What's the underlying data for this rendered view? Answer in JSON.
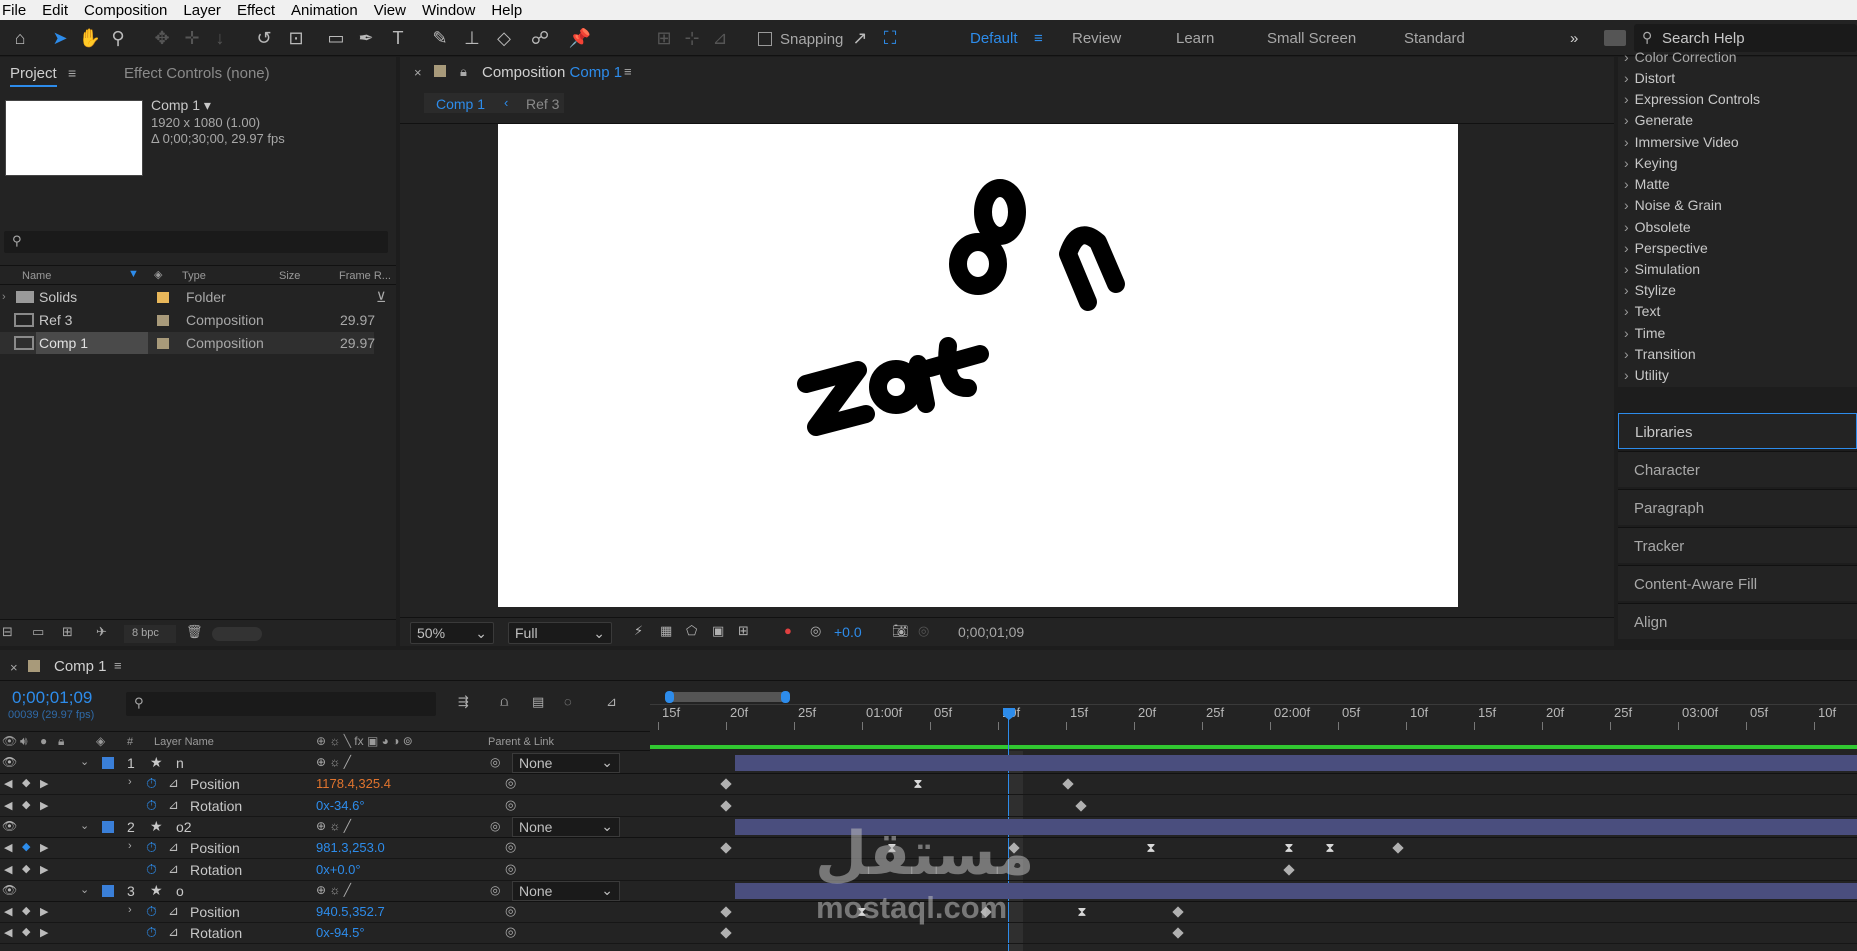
{
  "menubar": [
    "File",
    "Edit",
    "Composition",
    "Layer",
    "Effect",
    "Animation",
    "View",
    "Window",
    "Help"
  ],
  "toolbar": {
    "snapping": "Snapping",
    "workspaces": [
      "Default",
      "Review",
      "Learn",
      "Small Screen",
      "Standard"
    ],
    "search_placeholder": "Search Help"
  },
  "project": {
    "tab": "Project",
    "effect_controls": "Effect Controls (none)",
    "comp_name": "Comp 1",
    "comp_res": "1920 x 1080 (1.00)",
    "comp_dur": "Δ 0;00;30;00, 29.97 fps",
    "columns": {
      "name": "Name",
      "type": "Type",
      "size": "Size",
      "frame": "Frame R..."
    },
    "items": [
      {
        "name": "Solids",
        "type": "Folder",
        "rate": ""
      },
      {
        "name": "Ref 3",
        "type": "Composition",
        "rate": "29.97"
      },
      {
        "name": "Comp 1",
        "type": "Composition",
        "rate": "29.97"
      }
    ],
    "bpc": "8 bpc"
  },
  "composition": {
    "title": "Composition",
    "title_comp": "Comp 1",
    "flow": [
      "Comp 1",
      "Ref 3"
    ],
    "zoom": "50%",
    "resolution": "Full",
    "exposure": "+0.0",
    "timecode": "0;00;01;09"
  },
  "effects": [
    "Color Correction",
    "Distort",
    "Expression Controls",
    "Generate",
    "Immersive Video",
    "Keying",
    "Matte",
    "Noise & Grain",
    "Obsolete",
    "Perspective",
    "Simulation",
    "Stylize",
    "Text",
    "Time",
    "Transition",
    "Utility"
  ],
  "side_panels": [
    "Libraries",
    "Character",
    "Paragraph",
    "Tracker",
    "Content-Aware Fill",
    "Align"
  ],
  "timeline": {
    "tab": "Comp 1",
    "timecode": "0;00;01;09",
    "frames": "00039 (29.97 fps)",
    "col_layer": "Layer Name",
    "col_parent": "Parent & Link",
    "ruler": [
      "15f",
      "20f",
      "25f",
      "01:00f",
      "05f",
      "10f",
      "15f",
      "20f",
      "25f",
      "02:00f",
      "05f",
      "10f",
      "15f",
      "20f",
      "25f",
      "03:00f",
      "05f",
      "10f"
    ],
    "layers": [
      {
        "num": "1",
        "name": "n",
        "parent": "None",
        "pos": "1178.4,325.4",
        "rot": "0x-34.6°"
      },
      {
        "num": "2",
        "name": "o2",
        "parent": "None",
        "pos": "981.3,253.0",
        "rot": "0x+0.0°"
      },
      {
        "num": "3",
        "name": "o",
        "parent": "None",
        "pos": "940.5,352.7",
        "rot": "0x-94.5°"
      }
    ],
    "prop_position": "Position",
    "prop_rotation": "Rotation"
  },
  "watermark": {
    "arabic": "مستقل",
    "latin": "mostaql.com"
  }
}
